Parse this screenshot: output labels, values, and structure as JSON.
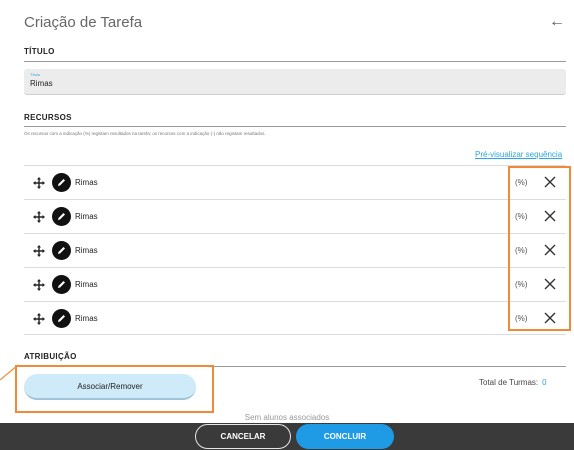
{
  "header": {
    "title": "Criação de Tarefa",
    "back_icon": "arrow-left-icon"
  },
  "titulo_section": {
    "heading": "TÍTULO",
    "field_label": "Título",
    "field_value": "Rimas"
  },
  "recursos_section": {
    "heading": "RECURSOS",
    "note": "Os recursos com a indicação (%) registam resultados na tarefa; os recursos com a indicação (-) não registam resultados.",
    "preview_link": "Pré-visualizar sequência",
    "items": [
      {
        "name": "Rimas",
        "indicator": "(%)"
      },
      {
        "name": "Rimas",
        "indicator": "(%)"
      },
      {
        "name": "Rimas",
        "indicator": "(%)"
      },
      {
        "name": "Rimas",
        "indicator": "(%)"
      },
      {
        "name": "Rimas",
        "indicator": "(%)"
      }
    ],
    "icons": {
      "move": "move-arrows-icon",
      "edit": "pencil-icon",
      "remove": "close-icon"
    }
  },
  "atribuicao_section": {
    "heading": "ATRIBUIÇÃO",
    "associate_button": "Associar/Remover",
    "total_label": "Total de Turmas:",
    "total_value": "0",
    "empty_text": "Sem alunos associados"
  },
  "footer": {
    "cancel_label": "CANCELAR",
    "conclude_label": "CONCLUIR"
  },
  "colors": {
    "accent": "#2aa6e0",
    "primary_button": "#1f9be6",
    "highlight": "#f08a3a",
    "footer_bg": "#3a3a3a"
  }
}
